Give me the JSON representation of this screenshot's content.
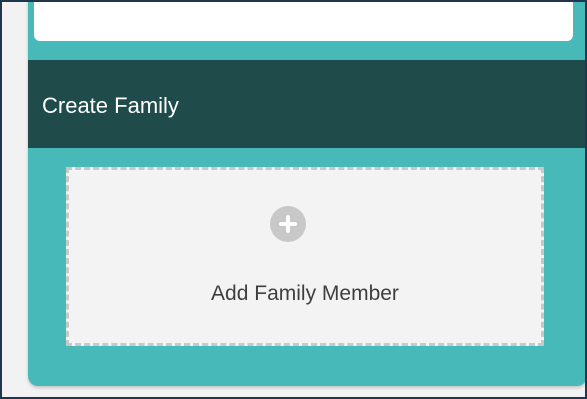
{
  "colors": {
    "accent": "#46b9b8",
    "header_bar": "#1f4b4b",
    "page_bg": "#f2f2f2",
    "dashed_border": "#c8c8c8",
    "plus_icon_bg": "#c8c8c8",
    "text_light": "#ffffff",
    "text_dark": "#3f3f3f"
  },
  "create_family": {
    "title": "Create Family",
    "add_member": {
      "icon": "plus-circle-icon",
      "label": "Add Family Member"
    }
  }
}
